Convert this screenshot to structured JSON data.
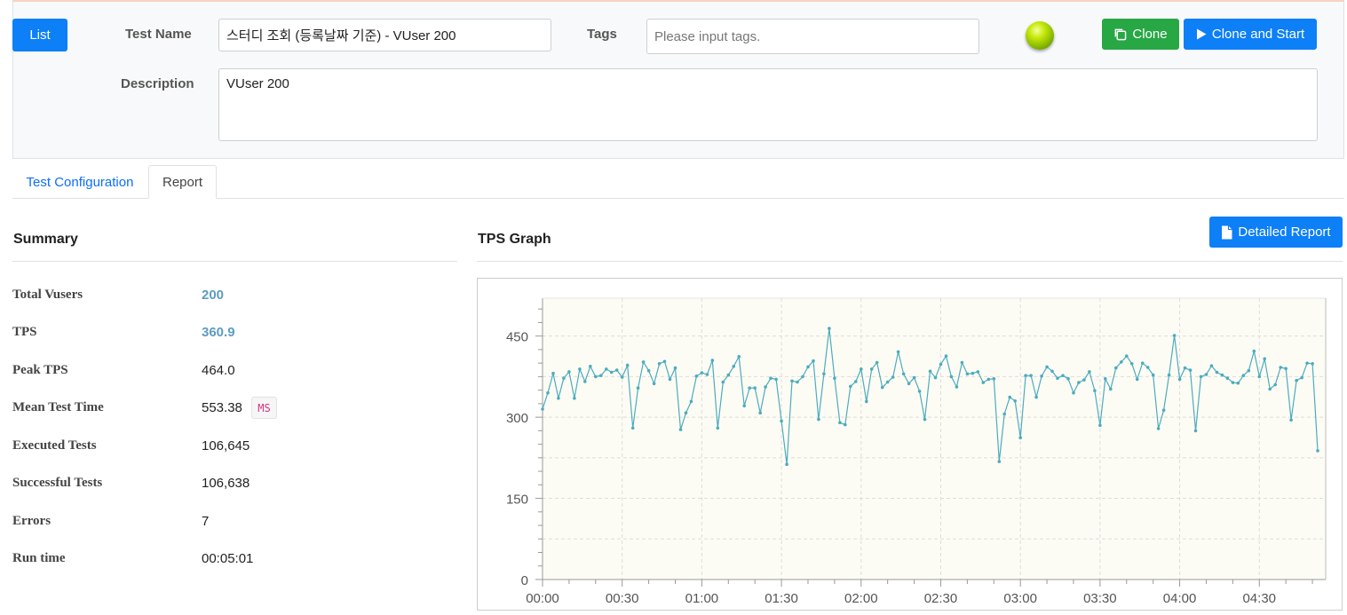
{
  "header": {
    "list_label": "List",
    "test_name_label": "Test Name",
    "test_name_value": "스터디 조회 (등록날짜 기준) - VUser 200",
    "tags_label": "Tags",
    "tags_placeholder": "Please input tags.",
    "clone_label": "Clone",
    "clone_start_label": "Clone and Start",
    "description_label": "Description",
    "description_value": "VUser 200",
    "status_color": "#9ccc00"
  },
  "tabs": [
    {
      "label": "Test Configuration",
      "active": false
    },
    {
      "label": "Report",
      "active": true
    }
  ],
  "summary": {
    "title": "Summary",
    "rows": [
      {
        "label": "Total Vusers",
        "value": "200",
        "link": true
      },
      {
        "label": "TPS",
        "value": "360.9",
        "link": true
      },
      {
        "label": "Peak TPS",
        "value": "464.0",
        "link": false
      },
      {
        "label": "Mean Test Time",
        "value": "553.38",
        "unit": "MS",
        "link": false
      },
      {
        "label": "Executed Tests",
        "value": "106,645",
        "link": false
      },
      {
        "label": "Successful Tests",
        "value": "106,638",
        "link": false
      },
      {
        "label": "Errors",
        "value": "7",
        "link": false
      },
      {
        "label": "Run time",
        "value": "00:05:01",
        "link": false
      }
    ]
  },
  "graph": {
    "title": "TPS Graph",
    "detailed_report_label": "Detailed Report"
  },
  "chart_data": {
    "type": "line",
    "x_unit": "seconds",
    "xlim": [
      0,
      295
    ],
    "ylim": [
      0,
      520
    ],
    "y_ticks": [
      0,
      150,
      300,
      450
    ],
    "x_tick_labels": [
      "00:00",
      "00:30",
      "01:00",
      "01:30",
      "02:00",
      "02:30",
      "03:00",
      "03:30",
      "04:00",
      "04:30"
    ],
    "x_tick_values": [
      0,
      30,
      60,
      90,
      120,
      150,
      180,
      210,
      240,
      270
    ],
    "color": "#4bacbf",
    "plot_bg": "#fdfcf4",
    "grid": true,
    "interval_seconds": 2,
    "values": [
      315,
      345,
      381,
      335,
      372,
      384,
      335,
      389,
      366,
      394,
      375,
      377,
      389,
      383,
      387,
      374,
      396,
      280,
      354,
      402,
      386,
      362,
      399,
      403,
      370,
      391,
      277,
      308,
      329,
      376,
      382,
      379,
      405,
      280,
      365,
      378,
      394,
      412,
      321,
      354,
      354,
      308,
      356,
      372,
      370,
      293,
      213,
      367,
      365,
      375,
      393,
      404,
      296,
      380,
      464,
      372,
      290,
      286,
      357,
      366,
      389,
      329,
      389,
      401,
      355,
      365,
      374,
      421,
      380,
      362,
      373,
      348,
      296,
      385,
      373,
      398,
      413,
      375,
      356,
      401,
      380,
      381,
      384,
      364,
      370,
      371,
      218,
      306,
      337,
      330,
      262,
      377,
      377,
      337,
      376,
      393,
      385,
      372,
      377,
      371,
      345,
      364,
      369,
      384,
      349,
      285,
      371,
      352,
      391,
      402,
      413,
      399,
      370,
      400,
      392,
      378,
      279,
      313,
      378,
      451,
      370,
      391,
      387,
      275,
      375,
      379,
      395,
      383,
      378,
      372,
      364,
      363,
      377,
      386,
      422,
      375,
      408,
      352,
      360,
      392,
      390,
      295,
      368,
      373,
      400,
      399,
      238
    ]
  }
}
